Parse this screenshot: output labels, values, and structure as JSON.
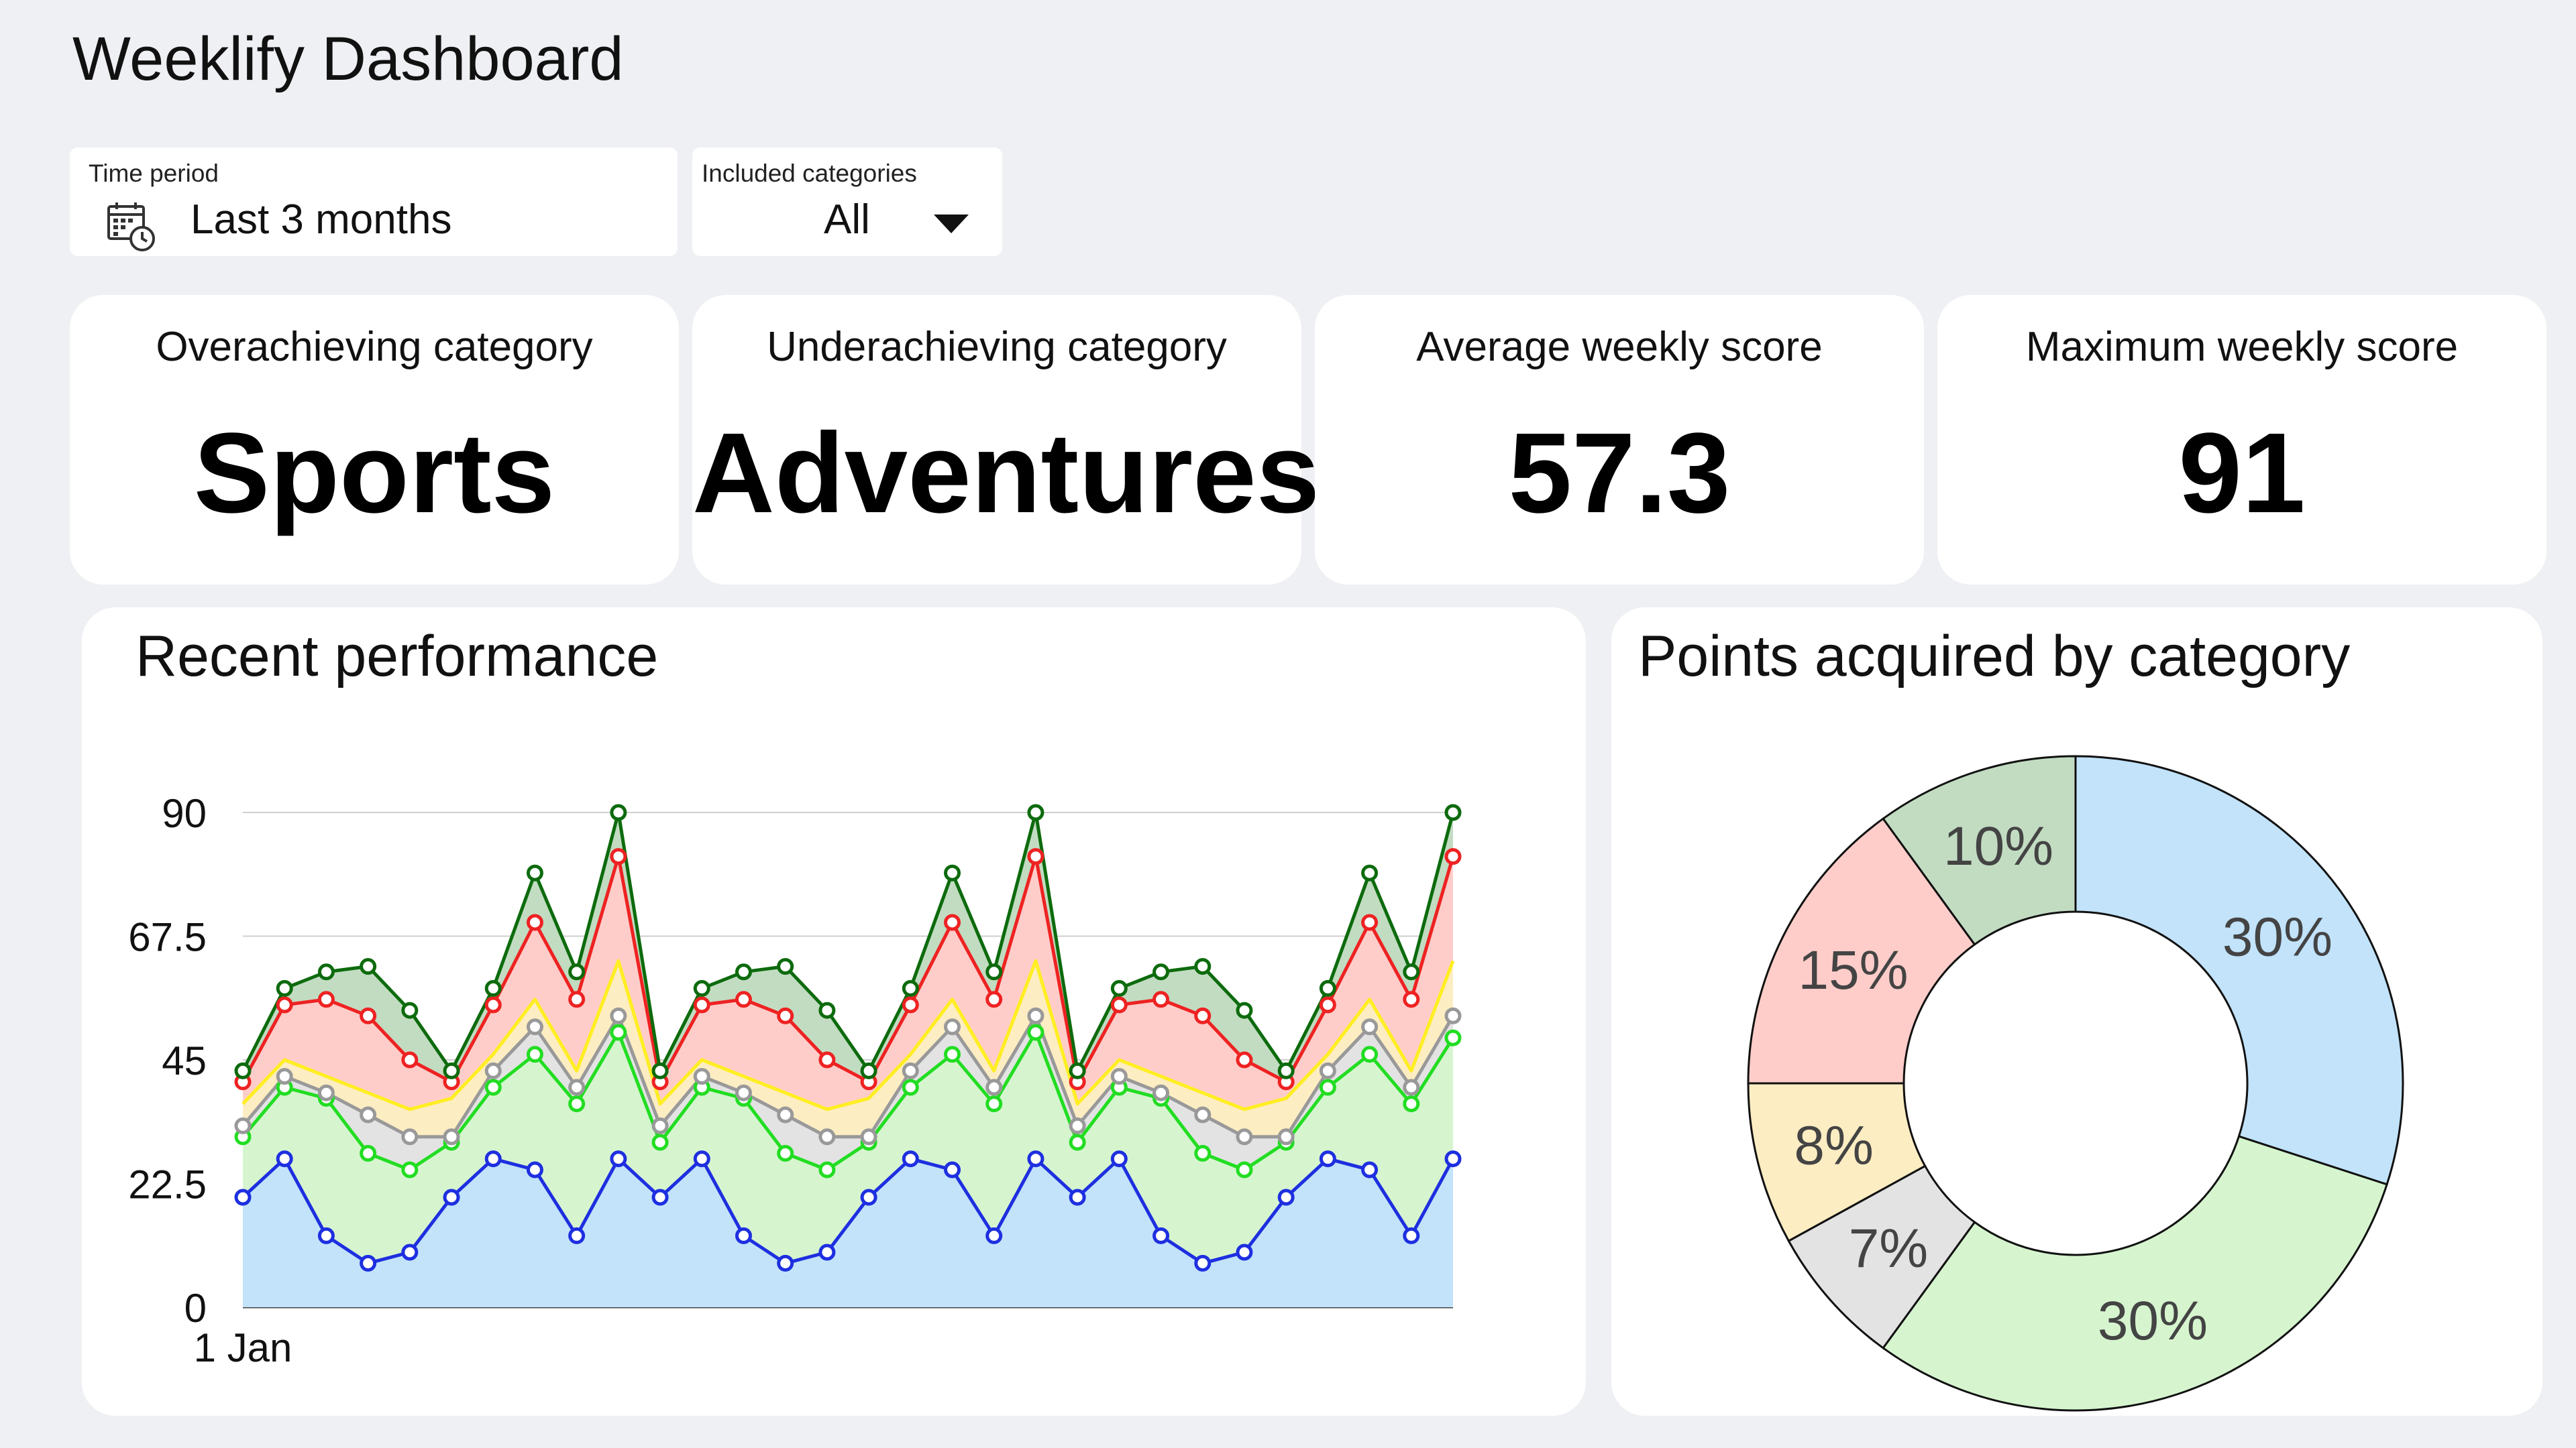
{
  "app": {
    "title": "Weeklify Dashboard"
  },
  "filters": {
    "time_period": {
      "label": "Time period",
      "value": "Last 3 months",
      "icon": "calendar-clock-icon"
    },
    "categories": {
      "label": "Included categories",
      "value": "All",
      "icon": "chevron-down-icon"
    }
  },
  "kpis": [
    {
      "label": "Overachieving category",
      "value": "Sports"
    },
    {
      "label": "Underachieving category",
      "value": "Adventures"
    },
    {
      "label": "Average weekly score",
      "value": "57.3"
    },
    {
      "label": "Maximum weekly score",
      "value": "91"
    }
  ],
  "performance": {
    "title": "Recent performance"
  },
  "distribution": {
    "title": "Points acquired by category"
  },
  "colors": {
    "blue_line": "#1e2fe0",
    "blue_fill": "#c2e3fa",
    "lgreen_line": "#22dd22",
    "lgreen_fill": "#d6f5cf",
    "gray_line": "#999999",
    "gray_fill": "#e3e3e3",
    "yellow_line": "#ffee22",
    "yellow_fill": "#fdedc2",
    "red_line": "#ee2222",
    "red_fill": "#ffcdc9",
    "dgreen_line": "#0d6b0d",
    "dgreen_fill": "#c2dcc2"
  },
  "chart_data": [
    {
      "type": "area",
      "title": "Recent performance",
      "stacked": true,
      "x_label_first": "1 Jan",
      "yticks": [
        "0",
        "22.5",
        "45",
        "67.5",
        "90"
      ],
      "ylim": [
        0,
        90
      ],
      "grid": true,
      "series": [
        {
          "color_key": "blue",
          "values": [
            20,
            27,
            13,
            8,
            10,
            20,
            27,
            25,
            13,
            27,
            20,
            27,
            13,
            8,
            10,
            20,
            27,
            25,
            13,
            27,
            20,
            27,
            13,
            8,
            10,
            20,
            27,
            25,
            13,
            27
          ]
        },
        {
          "color_key": "lgreen",
          "values": [
            31,
            40,
            38,
            28,
            25,
            30,
            40,
            46,
            37,
            50,
            30,
            40,
            38,
            28,
            25,
            30,
            40,
            46,
            37,
            50,
            30,
            40,
            38,
            28,
            25,
            30,
            40,
            46,
            37,
            49
          ]
        },
        {
          "color_key": "gray",
          "values": [
            33,
            42,
            39,
            35,
            31,
            31,
            43,
            51,
            40,
            53,
            33,
            42,
            39,
            35,
            31,
            31,
            43,
            51,
            40,
            53,
            33,
            42,
            39,
            35,
            31,
            31,
            43,
            51,
            40,
            53
          ]
        },
        {
          "color_key": "yellow",
          "values": [
            37,
            45,
            42,
            39,
            36,
            38,
            46,
            56,
            43,
            63,
            37,
            45,
            42,
            39,
            36,
            38,
            46,
            56,
            43,
            63,
            37,
            45,
            42,
            39,
            36,
            38,
            46,
            56,
            43,
            63
          ]
        },
        {
          "color_key": "red",
          "values": [
            41,
            55,
            56,
            53,
            45,
            41,
            55,
            70,
            56,
            82,
            41,
            55,
            56,
            53,
            45,
            41,
            55,
            70,
            56,
            82,
            41,
            55,
            56,
            53,
            45,
            41,
            55,
            70,
            56,
            82
          ]
        },
        {
          "color_key": "dgreen",
          "values": [
            43,
            58,
            61,
            62,
            54,
            43,
            58,
            79,
            61,
            90,
            43,
            58,
            61,
            62,
            54,
            43,
            58,
            79,
            61,
            90,
            43,
            58,
            61,
            62,
            54,
            43,
            58,
            79,
            61,
            90
          ]
        }
      ]
    },
    {
      "type": "pie",
      "title": "Points acquired by category",
      "donut": true,
      "slices": [
        {
          "label": "30%",
          "value": 30,
          "color_key": "blue"
        },
        {
          "label": "30%",
          "value": 30,
          "color_key": "lgreen"
        },
        {
          "label": "7%",
          "value": 7,
          "color_key": "gray"
        },
        {
          "label": "8%",
          "value": 8,
          "color_key": "yellow"
        },
        {
          "label": "15%",
          "value": 15,
          "color_key": "red"
        },
        {
          "label": "10%",
          "value": 10,
          "color_key": "dgreen"
        }
      ]
    }
  ]
}
